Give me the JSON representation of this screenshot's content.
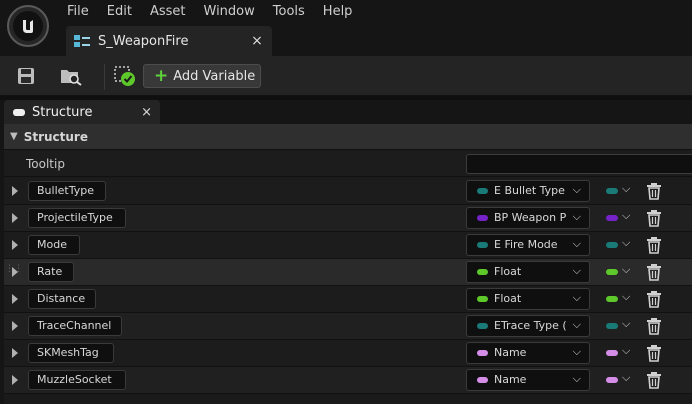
{
  "menu": [
    "File",
    "Edit",
    "Asset",
    "Window",
    "Tools",
    "Help"
  ],
  "document_tab": {
    "label": "S_WeaponFire",
    "close": "×"
  },
  "toolbar": {
    "add_variable_label": "Add Variable",
    "add_icon": "+"
  },
  "panel_tab": {
    "label": "Structure",
    "close": "×"
  },
  "section": {
    "title": "Structure",
    "caret": "▼"
  },
  "tooltip": {
    "label": "Tooltip",
    "value": ""
  },
  "colors": {
    "teal": "#1a7a78",
    "purple": "#7522c8",
    "green": "#5ec82b",
    "pink": "#d48ee8"
  },
  "rows": [
    {
      "name": "BulletType",
      "type": "E Bullet Type",
      "color": "#1a7a78"
    },
    {
      "name": "ProjectileType",
      "type": "BP Weapon Pr",
      "color": "#7522c8"
    },
    {
      "name": "Mode",
      "type": "E Fire Mode",
      "color": "#1a7a78"
    },
    {
      "name": "Rate",
      "type": "Float",
      "color": "#5ec82b"
    },
    {
      "name": "Distance",
      "type": "Float",
      "color": "#5ec82b"
    },
    {
      "name": "TraceChannel",
      "type": "ETrace Type (",
      "color": "#1a7a78"
    },
    {
      "name": "SKMeshTag",
      "type": "Name",
      "color": "#d48ee8"
    },
    {
      "name": "MuzzleSocket",
      "type": "Name",
      "color": "#d48ee8"
    }
  ],
  "icons": {
    "logo": "unreal-logo-icon",
    "save": "save-icon",
    "browse": "browse-icon",
    "validate": "validate-icon",
    "dropdown": "chevron-down-icon",
    "delete": "trash-icon"
  },
  "chevron": "⌵"
}
